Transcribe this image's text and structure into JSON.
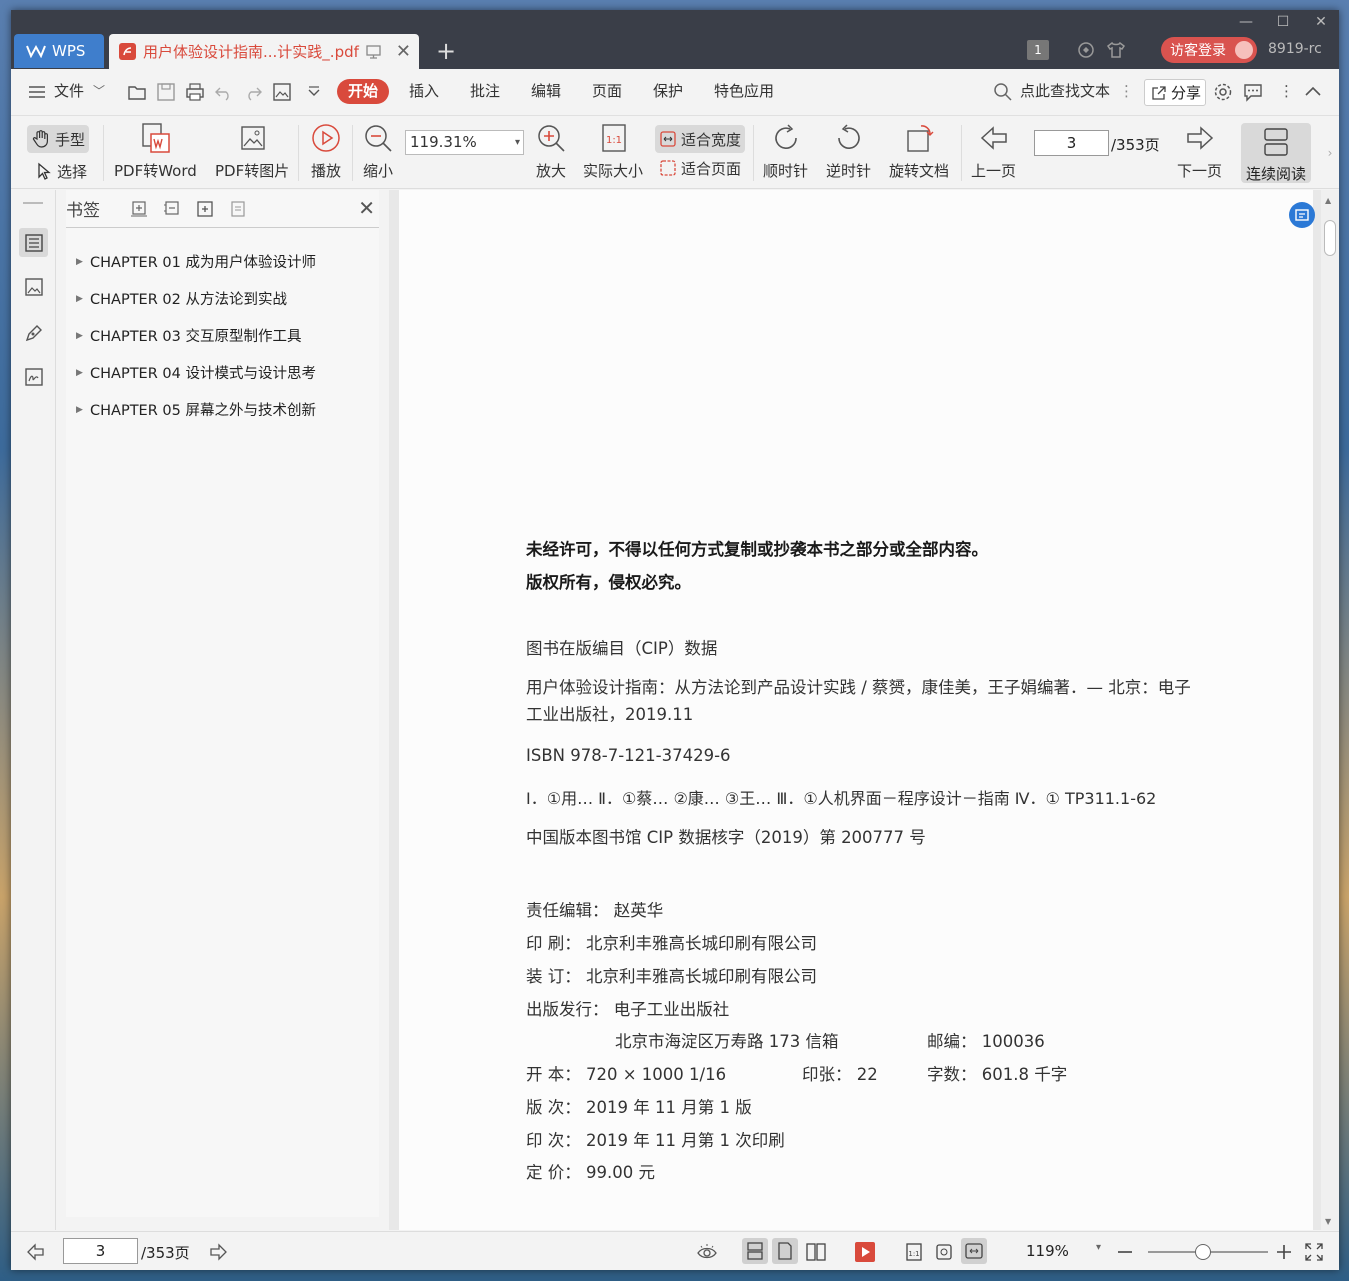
{
  "titlebar": {
    "app_tab": "WPS",
    "doc_tab": "用户体验设计指南...计实践_.pdf",
    "window_count": "1",
    "login": "访客登录",
    "user": "8919-rc"
  },
  "menubar": {
    "file": "文件",
    "tabs": [
      "开始",
      "插入",
      "批注",
      "编辑",
      "页面",
      "保护",
      "特色应用"
    ],
    "active_tab": "开始",
    "search": "点此查找文本",
    "share": "分享"
  },
  "toolbar": {
    "hand": "手型",
    "select": "选择",
    "pdf2word": "PDF转Word",
    "pdf2img": "PDF转图片",
    "play": "播放",
    "zoom_out": "缩小",
    "zoom_value": "119.31%",
    "zoom_in": "放大",
    "actual_size": "实际大小",
    "fit_width": "适合宽度",
    "fit_page": "适合页面",
    "rotate_cw": "顺时针",
    "rotate_ccw": "逆时针",
    "rotate_doc": "旋转文档",
    "prev_page": "上一页",
    "page_current": "3",
    "page_total": "/353页",
    "next_page": "下一页",
    "continuous": "连续阅读"
  },
  "bookmarks": {
    "title": "书签",
    "items": [
      "CHAPTER 01 成为用户体验设计师",
      "CHAPTER 02 从方法论到实战",
      "CHAPTER 03 交互原型制作工具",
      "CHAPTER 04 设计模式与设计思考",
      "CHAPTER 05 屏幕之外与技术创新"
    ]
  },
  "page": {
    "notice1": "未经许可，不得以任何方式复制或抄袭本书之部分或全部内容。",
    "notice2": "版权所有，侵权必究。",
    "cip_title": "图书在版编目（CIP）数据",
    "cip_line1": "用户体验设计指南：从方法论到产品设计实践 / 蔡赟，康佳美，王子娟编著．— 北京：电子",
    "cip_line2": "工业出版社，2019.11",
    "isbn": "ISBN 978-7-121-37429-6",
    "class": "Ⅰ．①用… Ⅱ．①蔡… ②康… ③王… Ⅲ．①人机界面－程序设计－指南 Ⅳ．① TP311.1-62",
    "cip_no": "中国版本图书馆 CIP 数据核字（2019）第 200777 号",
    "editor": "责任编辑：  赵英华",
    "print": "印      刷：  北京利丰雅高长城印刷有限公司",
    "bind": "装      订：  北京利丰雅高长城印刷有限公司",
    "publisher": "出版发行：  电子工业出版社",
    "address": "北京市海淀区万寿路 173 信箱",
    "postcode": "邮编：  100036",
    "format": "开      本：  720 × 1000   1/16",
    "sheets": "印张：  22",
    "words": "字数：  601.8 千字",
    "edition": "版      次：  2019 年 11 月第 1 版",
    "printing": "印      次：  2019 年 11 月第 1 次印刷",
    "price": "定      价：  99.00 元"
  },
  "status": {
    "page_current": "3",
    "page_total": "/353页",
    "zoom": "119%"
  }
}
